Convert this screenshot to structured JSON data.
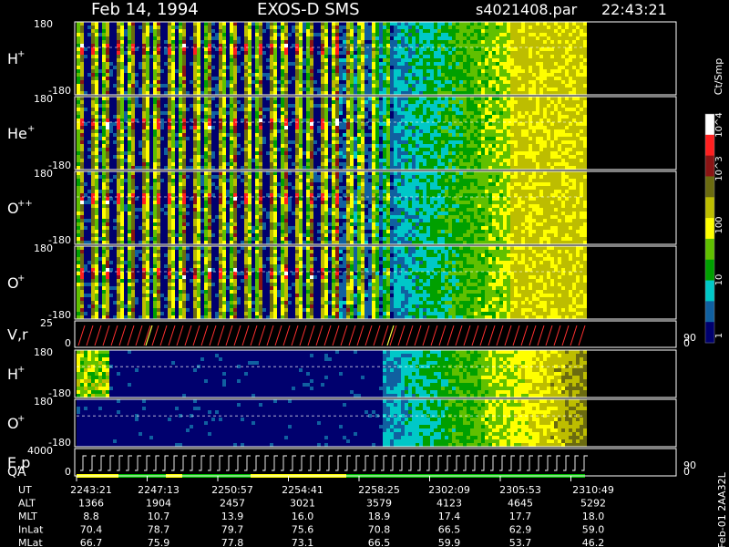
{
  "header": {
    "date": "Feb 14, 1994",
    "mission": "EXOS-D SMS",
    "file": "s4021408.par",
    "time": "22:43:21"
  },
  "colorbar": {
    "unit_label": "Ct/Smp",
    "ticks": [
      "10^4",
      "10^3",
      "100",
      "10",
      "1"
    ],
    "colors": [
      "#ffffff",
      "#ff2020",
      "#8a1414",
      "#6b6b10",
      "#bdbd00",
      "#ffff00",
      "#60c000",
      "#00a000",
      "#00c8c8",
      "#1060a0",
      "#00006e"
    ]
  },
  "panels": [
    {
      "id": "h-plus",
      "label": "H",
      "sup": "+",
      "ymax": "180",
      "ymin": "-180"
    },
    {
      "id": "he-plus",
      "label": "He",
      "sup": "+",
      "ymax": "180",
      "ymin": "-180"
    },
    {
      "id": "o-pp",
      "label": "O",
      "sup": "++",
      "ymax": "180",
      "ymin": "-180"
    },
    {
      "id": "o-plus",
      "label": "O",
      "sup": "+",
      "ymax": "180",
      "ymin": "-180"
    },
    {
      "id": "vr",
      "label": "V,r",
      "sup": "",
      "ymax": "25",
      "ymin": "0",
      "right_max": "90",
      "right_min": "0"
    },
    {
      "id": "h-plus-2",
      "label": "H",
      "sup": "+",
      "ymax": "180",
      "ymin": "-180"
    },
    {
      "id": "o-plus-2",
      "label": "O",
      "sup": "+",
      "ymax": "180",
      "ymin": "-180"
    },
    {
      "id": "ep",
      "label": "E,p",
      "sup": "",
      "ymax": "4000",
      "ymin": "0",
      "right_max": "90",
      "right_min": "0"
    }
  ],
  "qa_label": "QA",
  "footer_note": "Feb-01 2AA32L",
  "chart_data": {
    "type": "heatmap",
    "title": "Feb 14, 1994   EXOS-D SMS",
    "x_tick_labels": [
      "2243:21",
      "2247:13",
      "2250:57",
      "2254:41",
      "2258:25",
      "2302:09",
      "2305:53",
      "2310:49"
    ],
    "ephemeris": {
      "row_labels": [
        "UT",
        "ALT",
        "MLT",
        "InLat",
        "MLat"
      ],
      "ALT": [
        "1366",
        "1904",
        "2457",
        "3021",
        "3579",
        "4123",
        "4645",
        "5292"
      ],
      "MLT": [
        "8.8",
        "10.7",
        "13.9",
        "16.0",
        "18.9",
        "17.4",
        "17.7",
        "18.0"
      ],
      "InLat": [
        "70.4",
        "78.7",
        "79.7",
        "75.6",
        "70.8",
        "66.5",
        "62.9",
        "59.0"
      ],
      "MLat": [
        "66.7",
        "75.9",
        "77.8",
        "73.1",
        "66.5",
        "59.9",
        "53.7",
        "46.2"
      ]
    },
    "color_scale": {
      "min": 1,
      "max": 10000,
      "scale": "log",
      "unit": "Ct/Smp"
    }
  }
}
